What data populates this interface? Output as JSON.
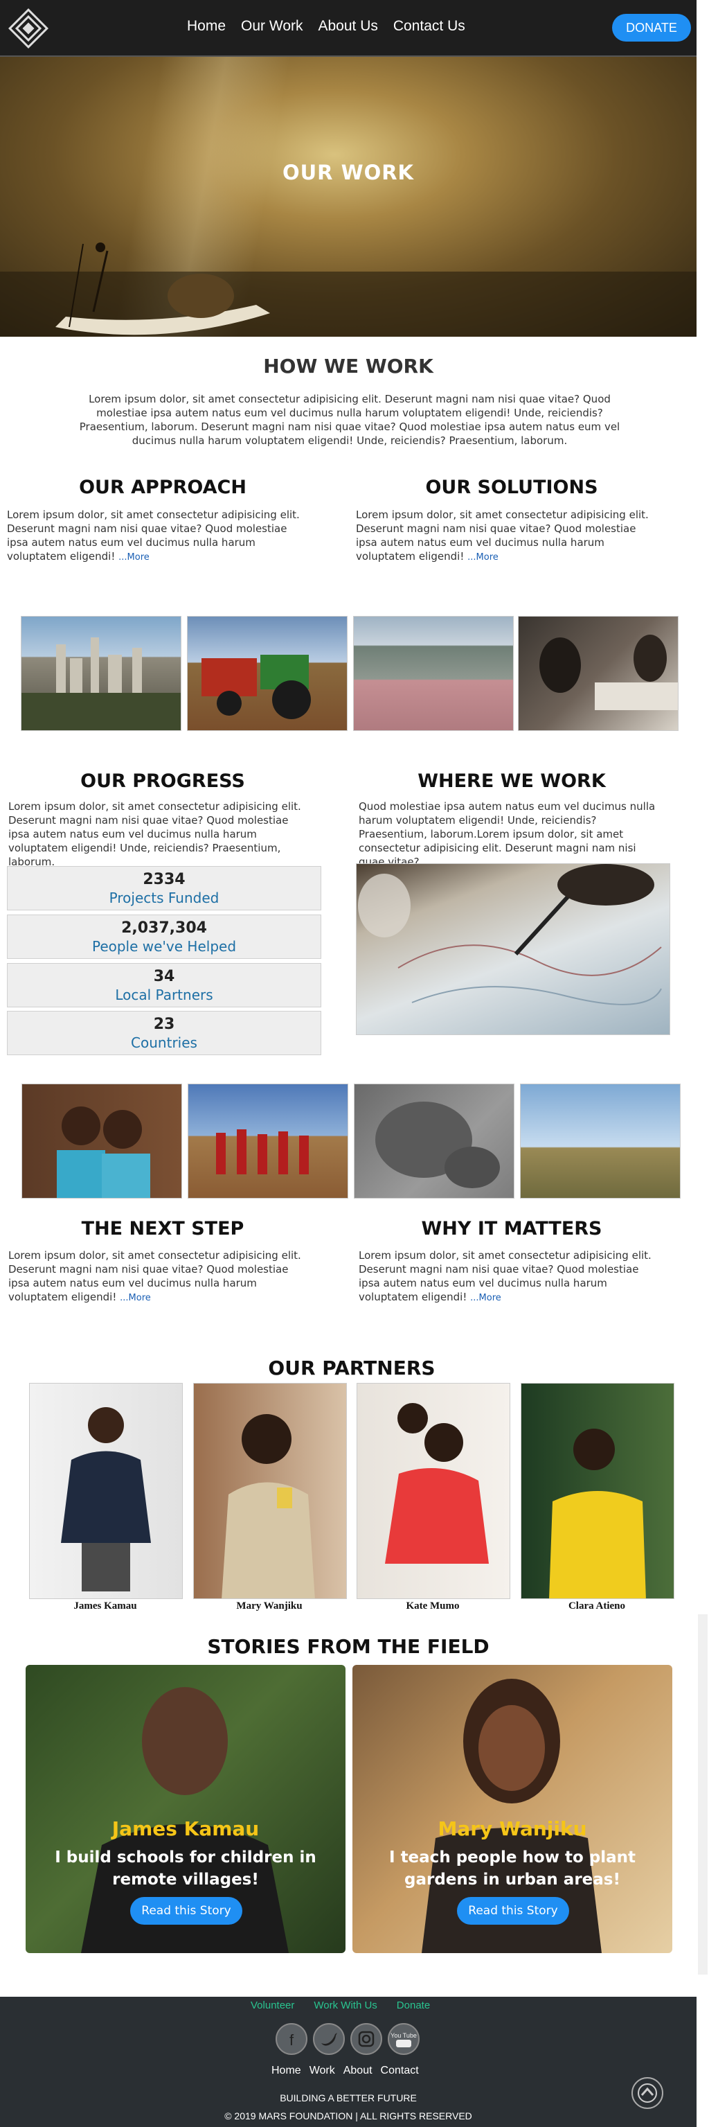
{
  "nav": {
    "links": [
      "Home",
      "Our Work",
      "About Us",
      "Contact Us"
    ],
    "donate": "DONATE"
  },
  "hero": {
    "title": "OUR WORK"
  },
  "how_we_work": {
    "title": "HOW WE WORK",
    "text": "Lorem ipsum dolor, sit amet consectetur adipisicing elit. Deserunt magni nam nisi quae vitae? Quod molestiae ipsa autem natus eum vel ducimus nulla harum voluptatem eligendi! Unde, reiciendis? Praesentium, laborum. Deserunt magni nam nisi quae vitae? Quod molestiae ipsa autem natus eum vel ducimus nulla harum voluptatem eligendi! Unde, reiciendis? Praesentium, laborum."
  },
  "approach": {
    "title": "OUR APPROACH",
    "text": "Lorem ipsum dolor, sit amet consectetur adipisicing elit. Deserunt magni nam nisi quae vitae? Quod molestiae ipsa autem natus eum vel ducimus nulla harum voluptatem eligendi!",
    "more": "...More"
  },
  "solutions": {
    "title": "OUR SOLUTIONS",
    "text": "Lorem ipsum dolor, sit amet consectetur adipisicing elit. Deserunt magni nam nisi quae vitae? Quod molestiae ipsa autem natus eum vel ducimus nulla harum voluptatem eligendi!",
    "more": "...More"
  },
  "progress": {
    "title": "OUR PROGRESS",
    "text": "Lorem ipsum dolor, sit amet consectetur adipisicing elit. Deserunt magni nam nisi quae vitae? Quod molestiae ipsa autem natus eum vel ducimus nulla harum voluptatem eligendi! Unde, reiciendis? Praesentium, laborum.",
    "stats": [
      {
        "value": "2334",
        "label": "Projects Funded"
      },
      {
        "value": "2,037,304",
        "label": "People we've Helped"
      },
      {
        "value": "34",
        "label": "Local Partners"
      },
      {
        "value": "23",
        "label": "Countries"
      }
    ]
  },
  "where": {
    "title": "WHERE WE WORK",
    "text": "Quod molestiae ipsa autem natus eum vel ducimus nulla harum voluptatem eligendi! Unde, reiciendis? Praesentium, laborum.Lorem ipsum dolor, sit amet consectetur adipisicing elit. Deserunt magni nam nisi quae vitae?"
  },
  "next_step": {
    "title": "THE NEXT STEP",
    "text": "Lorem ipsum dolor, sit amet consectetur adipisicing elit. Deserunt magni nam nisi quae vitae? Quod molestiae ipsa autem natus eum vel ducimus nulla harum voluptatem eligendi!",
    "more": "...More"
  },
  "why": {
    "title": "WHY IT MATTERS",
    "text": "Lorem ipsum dolor, sit amet consectetur adipisicing elit. Deserunt magni nam nisi quae vitae? Quod molestiae ipsa autem natus eum vel ducimus nulla harum voluptatem eligendi!",
    "more": "...More"
  },
  "partners": {
    "title": "OUR PARTNERS",
    "names": [
      "James Kamau",
      "Mary Wanjiku",
      "Kate Mumo",
      "Clara Atieno"
    ]
  },
  "stories": {
    "title": "STORIES FROM THE FIELD",
    "cards": [
      {
        "name": "James Kamau",
        "quote": "I build schools for children in remote villages!",
        "button": "Read this Story"
      },
      {
        "name": "Mary Wanjiku",
        "quote": "I teach people how to plant gardens in urban areas!",
        "button": "Read this Story"
      }
    ]
  },
  "footer": {
    "top_links": [
      "Volunteer",
      "Work With Us",
      "Donate"
    ],
    "social_icons": [
      "facebook-icon",
      "twitter-icon",
      "instagram-icon",
      "youtube-icon"
    ],
    "youtube_label": "You Tube",
    "links": [
      "Home",
      "Work",
      "About",
      "Contact"
    ],
    "tagline": "BUILDING A BETTER FUTURE",
    "copyright": "© 2019 MARS FOUNDATION | ALL RIGHTS RESERVED"
  },
  "colors": {
    "accent": "#1f8ff3",
    "story_name": "#f5c518",
    "footer_link": "#29c490",
    "stat_label": "#1d6fa5"
  }
}
